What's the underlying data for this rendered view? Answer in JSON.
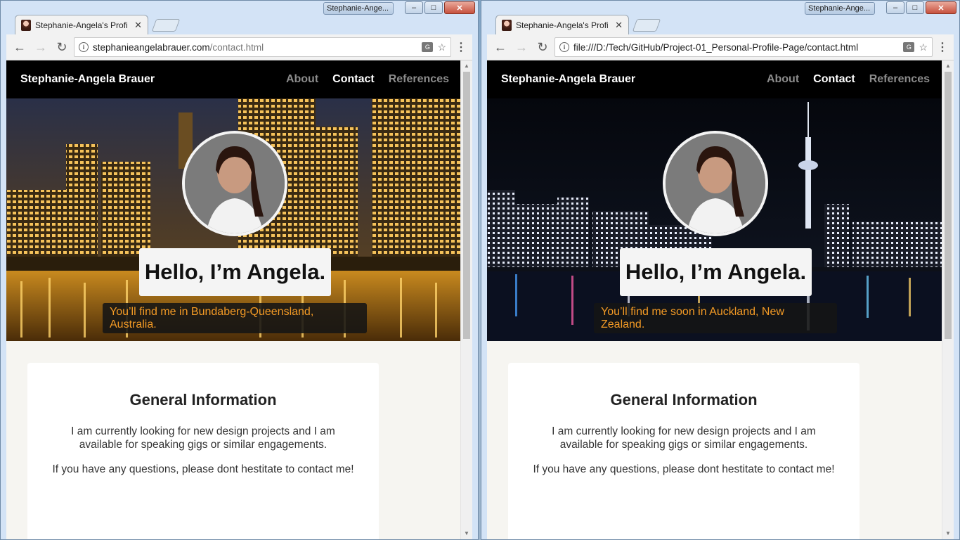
{
  "windows": {
    "left": {
      "taskbar_title": "Stephanie-Ange...",
      "tab_title": "Stephanie-Angela's Profi",
      "url_host": "stephanieangelabrauer.com",
      "url_path": "/contact.html",
      "hero_location": "You’ll find me in Bundaberg-Queensland, Australia."
    },
    "right": {
      "taskbar_title": "Stephanie-Ange...",
      "tab_title": "Stephanie-Angela's Profi",
      "url_host": "file:///D:/Tech/GitHub/Project-01_Personal-Profile-Page/contact.html",
      "url_path": "",
      "hero_location": "You’ll find me soon in Auckland, New Zealand."
    }
  },
  "site": {
    "brand": "Stephanie-Angela Brauer",
    "nav": [
      "About",
      "Contact",
      "References"
    ],
    "active_nav": "Contact",
    "hero_heading": "Hello, I’m Angela.",
    "card_title": "General Information",
    "card_paragraphs": [
      "I am currently looking for new design projects and I am available for speaking gigs or similar engagements.",
      "If you have any questions, please dont hestitate to contact me!"
    ]
  },
  "colors": {
    "accent_orange": "#f39a25",
    "nav_bg": "#000000",
    "page_bg": "#f6f5f1"
  },
  "icons": {
    "back": "arrow-left-icon",
    "forward": "arrow-right-icon",
    "reload": "reload-icon",
    "info": "info-icon",
    "translate": "translate-icon",
    "bookmark": "star-icon",
    "menu": "kebab-menu-icon"
  }
}
